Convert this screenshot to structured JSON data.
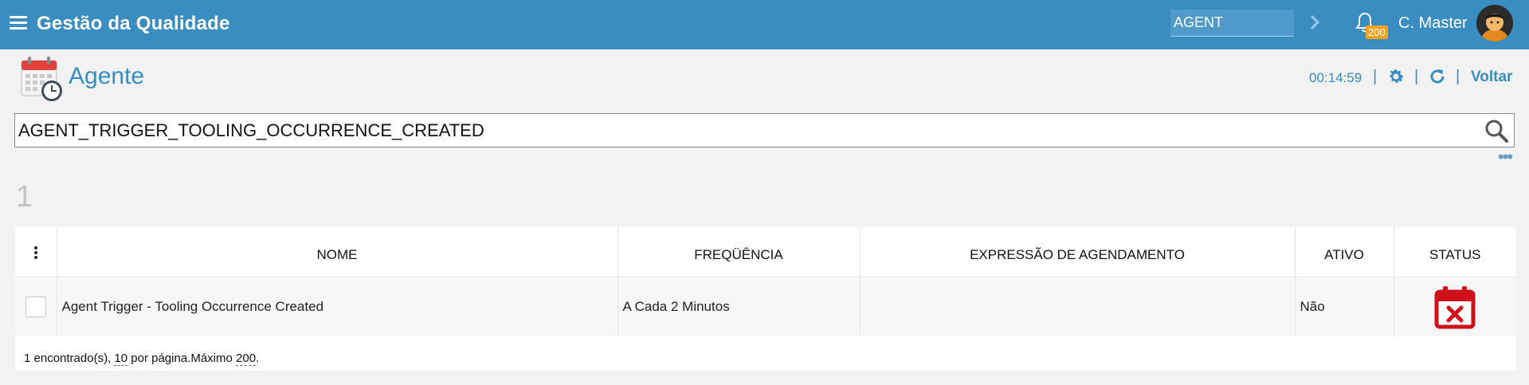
{
  "app": {
    "title": "Gestão da Qualidade"
  },
  "header": {
    "module_value": "AGENT",
    "notification_count": "200",
    "user_name": "C. Master"
  },
  "page": {
    "title": "Agente",
    "timer": "00:14:59",
    "back_label": "Voltar"
  },
  "search": {
    "value": "AGENT_TRIGGER_TOOLING_OCCURRENCE_CREATED"
  },
  "results": {
    "count": "1"
  },
  "table": {
    "columns": [
      "NOME",
      "FREQÜÊNCIA",
      "EXPRESSÃO DE AGENDAMENTO",
      "ATIVO",
      "STATUS"
    ],
    "rows": [
      {
        "nome": "Agent Trigger - Tooling Occurrence Created",
        "frequencia": "A Cada 2 Minutos",
        "expressao": "",
        "ativo": "Não",
        "status_icon": "calendar-cancel-icon"
      }
    ]
  },
  "pager": {
    "found": "1 encontrado(s),",
    "per_page": "10",
    "per_page_suffix": "por página.Máximo",
    "max": "200",
    "end": "."
  },
  "colors": {
    "topbar": "#3a8dc0",
    "accent": "#3a8dc0",
    "badge": "#f2a21c",
    "status_red": "#d0111b"
  }
}
